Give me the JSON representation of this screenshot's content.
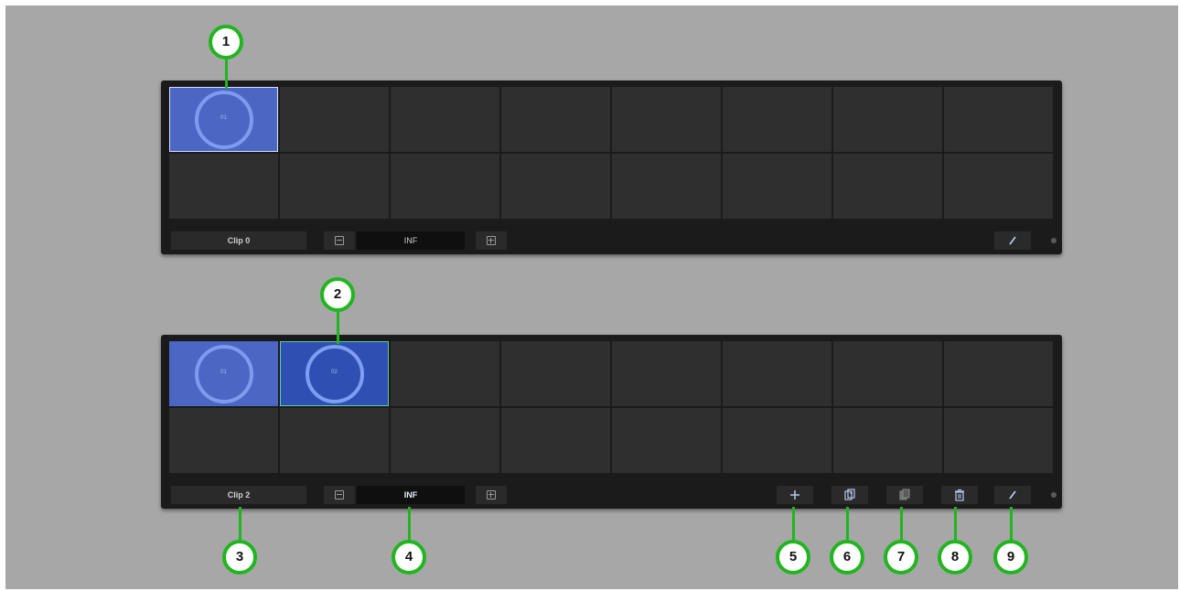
{
  "top_panel": {
    "clips": [
      "01"
    ],
    "clip_name": "Clip 0",
    "loop_value": "INF"
  },
  "bottom_panel": {
    "clips": [
      "01",
      "02"
    ],
    "clip_name": "Clip 2",
    "loop_value": "INF",
    "toolbar": {
      "add_icon": "plus-icon",
      "duplicate_icon": "duplicate-icon",
      "copy_icon": "copy-icon",
      "delete_icon": "trash-icon",
      "edit_icon": "pencil-icon"
    }
  },
  "callouts": [
    "1",
    "2",
    "3",
    "4",
    "5",
    "6",
    "7",
    "8",
    "9"
  ],
  "colors": {
    "background": "#a7a7a7",
    "panel": "#1b1b1b",
    "clip_selected": "#4c66c4",
    "clip_active": "#2f4fb2",
    "callout_border": "#21b51f"
  }
}
